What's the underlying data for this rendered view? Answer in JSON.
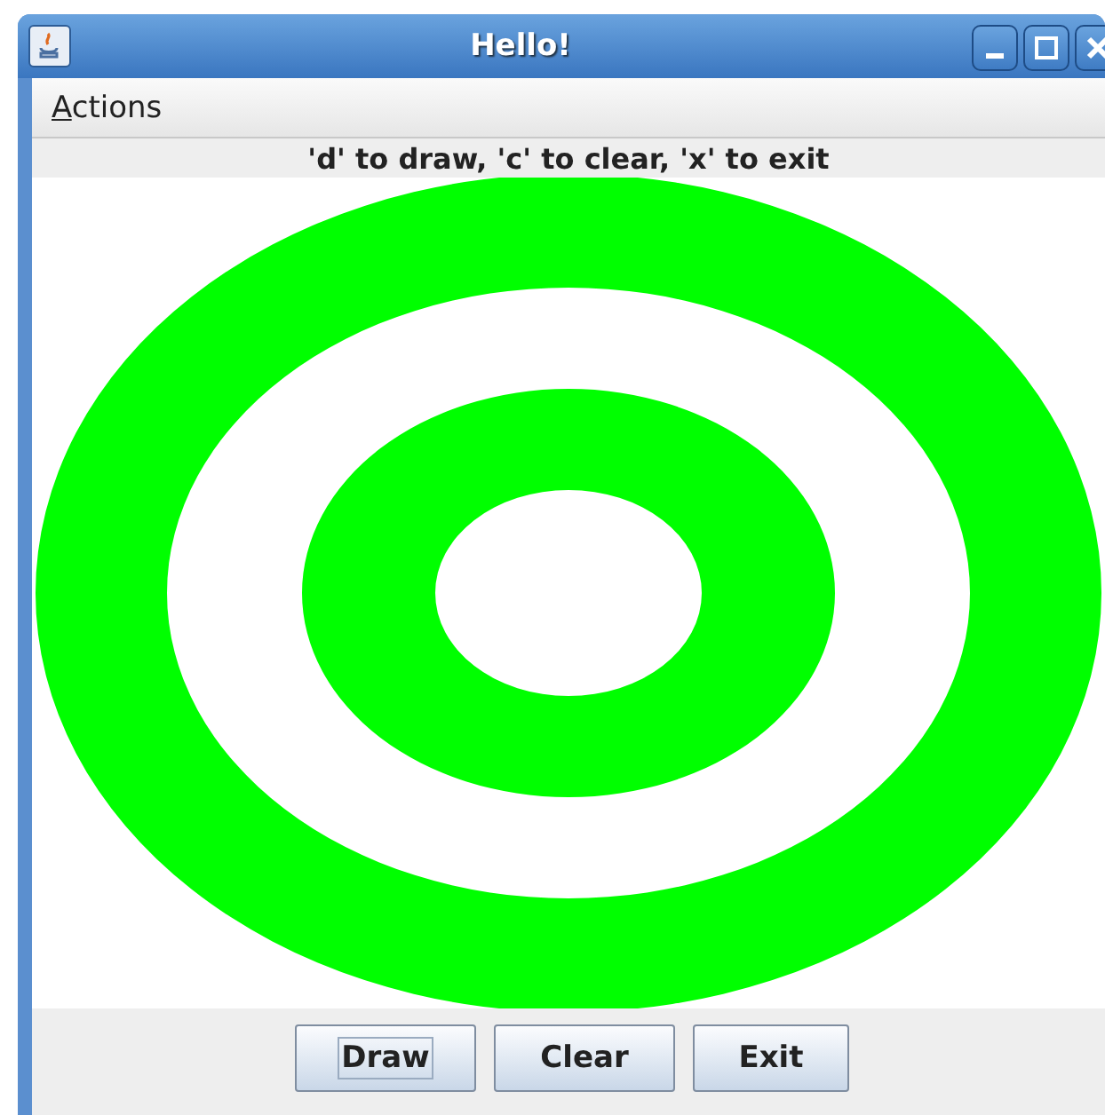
{
  "window": {
    "title": "Hello!"
  },
  "menu": [
    {
      "label": "Actions",
      "mnemonic_underlined": true
    }
  ],
  "hint": "'d' to draw, 'c' to clear, 'x' to exit",
  "buttons": [
    {
      "label": "Draw",
      "focused": true
    },
    {
      "label": "Clear",
      "focused": false
    },
    {
      "label": "Exit",
      "focused": false
    }
  ]
}
